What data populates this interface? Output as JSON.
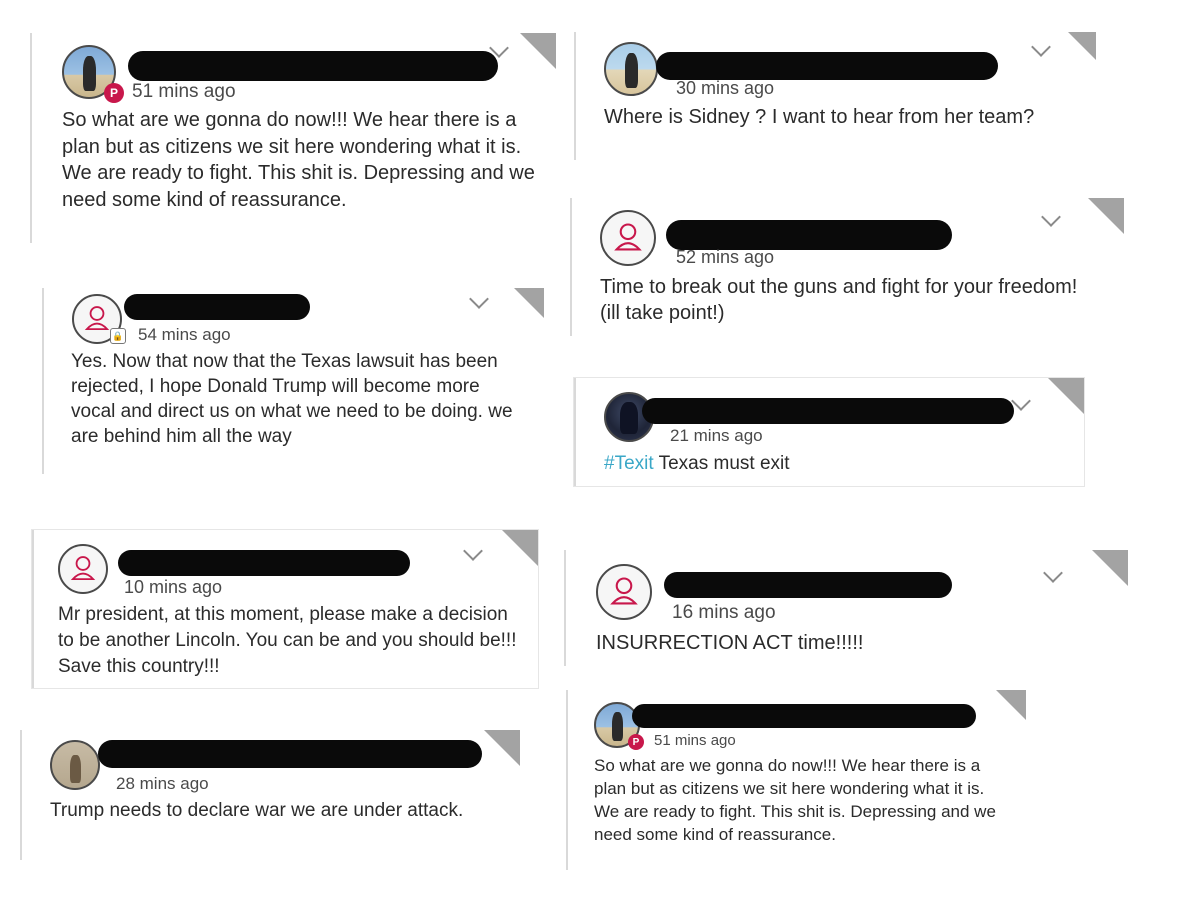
{
  "posts": [
    {
      "time": "51 mins ago",
      "text": "So what are we gonna do now!!! We hear there is a plan but as citizens we sit here wondering what it is. We are ready to fight. This shit is. Depressing and we need some kind of reassurance.",
      "avatar": "photo-avatar",
      "badge": "parler-badge-icon"
    },
    {
      "time": "54 mins ago",
      "text": "Yes. Now that now that the Texas lawsuit has been rejected, I hope Donald Trump will become more vocal and direct us on what we need to be doing. we are behind him all the way",
      "avatar": "default-user-icon",
      "badge": "lock-badge-icon"
    },
    {
      "time": "10 mins ago",
      "text": "Mr president, at this moment, please make a decision to be another Lincoln. You can be and you should be!!! Save this country!!!",
      "avatar": "default-user-icon"
    },
    {
      "time": "28 mins ago",
      "text": "Trump needs to declare war we are under attack.",
      "avatar": "photo-avatar"
    },
    {
      "time": "30 mins ago",
      "text": "Where is Sidney ? I want to hear from her team?",
      "avatar": "photo-avatar"
    },
    {
      "time": "52 mins ago",
      "text": "Time to break out the guns and fight for your freedom! (ill take point!)",
      "avatar": "default-user-icon"
    },
    {
      "time": "21 mins ago",
      "hashtag": "#Texit",
      "text": " Texas must exit",
      "avatar": "photo-avatar"
    },
    {
      "time": "16 mins ago",
      "text": "INSURRECTION ACT time!!!!!",
      "avatar": "default-user-icon"
    },
    {
      "time": "51 mins ago",
      "text": "So what are we gonna do now!!! We hear there is a plan but as citizens we sit here wondering what it is. We are ready to fight. This shit is. Depressing and we need some kind of reassurance.",
      "avatar": "photo-avatar",
      "badge": "parler-badge-icon"
    }
  ],
  "colors": {
    "hashtag": "#3aa7c7",
    "parler_badge": "#c8174b",
    "redaction": "#0a0a0a",
    "corner_flag": "#a3a3a3"
  }
}
